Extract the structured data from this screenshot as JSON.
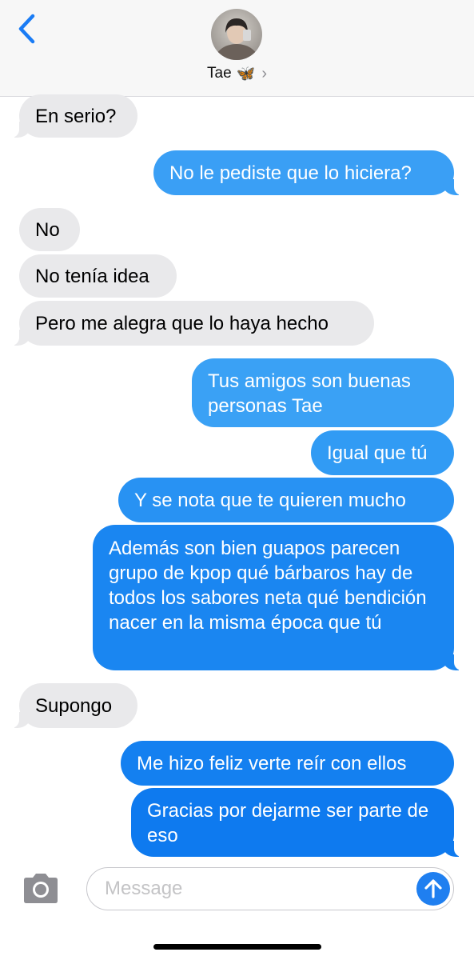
{
  "header": {
    "contact_name": "Tae",
    "contact_emoji": "🦋",
    "chevron": "›",
    "back_icon": "chevron-left-icon",
    "avatar_icon": "contact-avatar"
  },
  "colors": {
    "incoming_bubble": "#e9e9eb",
    "outgoing_gradient_top": "#4aa8f6",
    "outgoing_gradient_bottom": "#0a71ec",
    "accent": "#1f7ff0"
  },
  "messages": [
    {
      "direction": "incoming",
      "text": "En serio?"
    },
    {
      "direction": "outgoing",
      "text": "No le pediste que lo hiciera?"
    },
    {
      "direction": "incoming",
      "text": "No"
    },
    {
      "direction": "incoming",
      "text": "No tenía idea"
    },
    {
      "direction": "incoming",
      "text": "Pero me alegra que lo haya hecho"
    },
    {
      "direction": "outgoing",
      "text": "Tus amigos son buenas personas Tae"
    },
    {
      "direction": "outgoing",
      "text": "Igual que tú"
    },
    {
      "direction": "outgoing",
      "text": "Y se nota que te quieren mucho"
    },
    {
      "direction": "outgoing",
      "text": "Además son bien guapos parecen grupo de kpop qué bárbaros hay de todos los sabores neta qué bendición nacer en la misma época que tú"
    },
    {
      "direction": "incoming",
      "text": "Supongo"
    },
    {
      "direction": "outgoing",
      "text": "Me hizo feliz verte reír con ellos"
    },
    {
      "direction": "outgoing",
      "text": "Gracias por dejarme ser parte de eso"
    }
  ],
  "composer": {
    "placeholder": "Message",
    "camera_icon": "camera-icon",
    "send_icon": "send-arrow-up-icon"
  }
}
